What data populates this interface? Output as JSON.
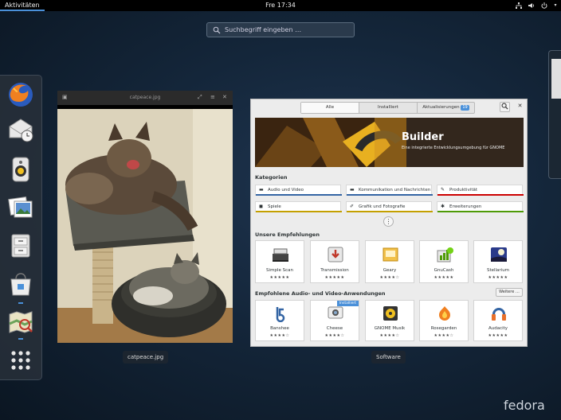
{
  "topbar": {
    "activities": "Aktivitäten",
    "clock": "Fre 17:34",
    "icons": [
      "network-icon",
      "volume-icon",
      "power-icon"
    ]
  },
  "search": {
    "placeholder": "Suchbegriff eingeben …"
  },
  "dash": {
    "apps": [
      "firefox-icon",
      "evolution-mail-icon",
      "rhythmbox-icon",
      "shotwell-icon",
      "file-manager-icon",
      "software-icon",
      "gnome-maps-icon"
    ],
    "show_apps": "show-apps-icon"
  },
  "window_image": {
    "title": "catpeace.jpg",
    "label": "catpeace.jpg"
  },
  "window_software": {
    "label": "Software",
    "tabs": [
      {
        "label": "Alle"
      },
      {
        "label": "Installiert"
      },
      {
        "label": "Aktualisierungen",
        "badge": "19"
      }
    ],
    "banner": {
      "title": "Builder",
      "subtitle": "Eine integrierte Entwicklungsumgebung für GNOME"
    },
    "categories_title": "Kategorien",
    "categories": [
      {
        "label": "Audio und Video",
        "color": "#3465a4"
      },
      {
        "label": "Kommunikation und Nachrichten",
        "color": "#3465a4"
      },
      {
        "label": "Produktivität",
        "color": "#cc0000"
      },
      {
        "label": "Spiele",
        "color": "#c4a000"
      },
      {
        "label": "Grafik und Fotografie",
        "color": "#c4a000"
      },
      {
        "label": "Erweiterungen",
        "color": "#4e9a06"
      }
    ],
    "more": "⋮",
    "recommended_title": "Unsere Empfehlungen",
    "recommended": [
      {
        "name": "Simple Scan",
        "stars": "★★★★★"
      },
      {
        "name": "Transmission",
        "stars": "★★★★★"
      },
      {
        "name": "Geary",
        "stars": "★★★★☆"
      },
      {
        "name": "GnuCash",
        "stars": "★★★★★"
      },
      {
        "name": "Stellarium",
        "stars": "★★★★★"
      }
    ],
    "audio_title": "Empfohlene Audio- und Video-Anwendungen",
    "more_button": "Weitere …",
    "installed_badge": "Installiert",
    "audio": [
      {
        "name": "Banshee",
        "stars": "★★★★☆"
      },
      {
        "name": "Cheese",
        "stars": "★★★★☆"
      },
      {
        "name": "GNOME Musik",
        "stars": "★★★★☆"
      },
      {
        "name": "Rosegarden",
        "stars": "★★★★☆"
      },
      {
        "name": "Audacity",
        "stars": "★★★★★"
      }
    ]
  },
  "branding": {
    "logo": "fedora"
  }
}
